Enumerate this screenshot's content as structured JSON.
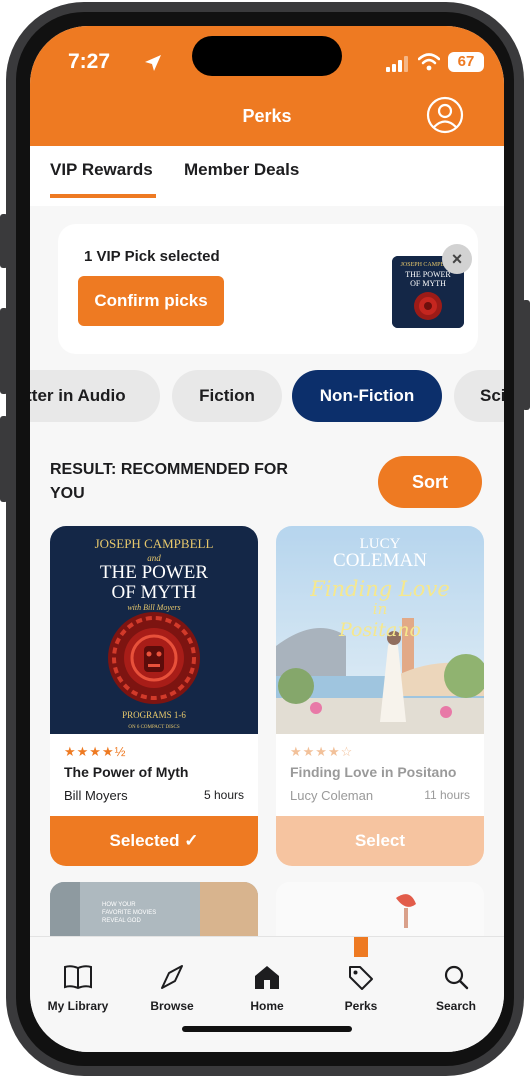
{
  "status": {
    "time": "7:27",
    "battery": "67"
  },
  "header": {
    "title": "Perks"
  },
  "tabs": [
    {
      "label": "VIP Rewards",
      "active": true
    },
    {
      "label": "Member Deals",
      "active": false
    }
  ],
  "vip": {
    "selected_text": "1 VIP Pick selected",
    "confirm_label": "Confirm picks",
    "remove_glyph": "×"
  },
  "chips": [
    {
      "label": "Better in Audio",
      "active": false
    },
    {
      "label": "Fiction",
      "active": false
    },
    {
      "label": "Non-Fiction",
      "active": true
    },
    {
      "label": "Science",
      "active": false
    }
  ],
  "results": {
    "title": "RESULT: RECOMMENDED FOR YOU",
    "sort_label": "Sort"
  },
  "books": [
    {
      "cover": {
        "line1": "JOSEPH CAMPBELL",
        "line2": "and",
        "line3": "THE POWER",
        "line4": "OF MYTH",
        "line5": "with Bill Moyers",
        "line6": "PROGRAMS 1-6",
        "line7": "ON 6 COMPACT DISCS"
      },
      "rating": 4.5,
      "stars": "★★★★½",
      "title": "The Power of Myth",
      "author": "Bill Moyers",
      "length": "5 hours",
      "button": "Selected ✓",
      "state": "selected"
    },
    {
      "cover": {
        "line1": "LUCY",
        "line2": "COLEMAN",
        "line3": "Finding Love",
        "line4": "in",
        "line5": "Positano"
      },
      "rating": 4,
      "stars": "★★★★☆",
      "title": "Finding Love in Positano",
      "author": "Lucy Coleman",
      "length": "11 hours",
      "button": "Select",
      "state": "disabled"
    }
  ],
  "peek": {
    "line1": "HOW YOUR",
    "line2": "FAVORITE MOVIES",
    "line3": "REVEAL GOD"
  },
  "nav": [
    {
      "label": "My Library",
      "icon": "book-icon"
    },
    {
      "label": "Browse",
      "icon": "compass-icon"
    },
    {
      "label": "Home",
      "icon": "home-icon"
    },
    {
      "label": "Perks",
      "icon": "tag-icon",
      "active": true
    },
    {
      "label": "Search",
      "icon": "search-icon"
    }
  ],
  "colors": {
    "accent": "#ee7a22",
    "navy": "#0c2f6b",
    "background": "#f7f7f7"
  }
}
